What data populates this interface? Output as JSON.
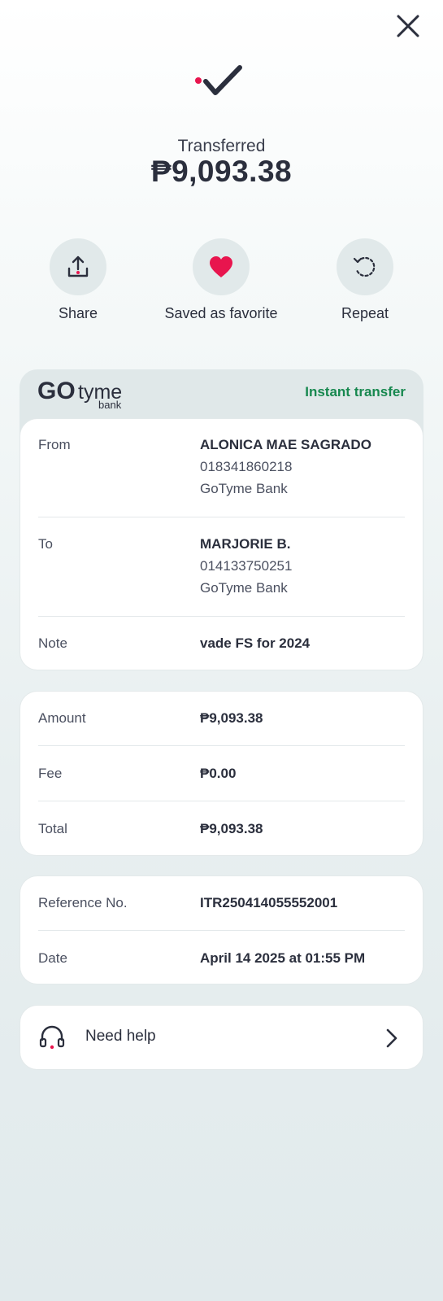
{
  "header": {
    "close_icon": "close-icon"
  },
  "status": {
    "icon": "checkmark-icon",
    "label": "Transferred",
    "amount": "₱9,093.38"
  },
  "actions": [
    {
      "label": "Share",
      "icon": "share-upload-icon"
    },
    {
      "label": "Saved as favorite",
      "icon": "heart-icon"
    },
    {
      "label": "Repeat",
      "icon": "repeat-icon"
    }
  ],
  "bank": {
    "logo_main": "GOtyme",
    "logo_sub": "bank",
    "transfer_type": "Instant transfer"
  },
  "details": {
    "from": {
      "label": "From",
      "name": "ALONICA MAE SAGRADO",
      "account": "018341860218",
      "bank": "GoTyme Bank"
    },
    "to": {
      "label": "To",
      "name": "MARJORIE B.",
      "account": "014133750251",
      "bank": "GoTyme Bank"
    },
    "note": {
      "label": "Note",
      "value": "vade FS for 2024"
    }
  },
  "summary": {
    "amount": {
      "label": "Amount",
      "value": "₱9,093.38"
    },
    "fee": {
      "label": "Fee",
      "value": "₱0.00"
    },
    "total": {
      "label": "Total",
      "value": "₱9,093.38"
    }
  },
  "reference": {
    "ref": {
      "label": "Reference No.",
      "value": "ITR250414055552001"
    },
    "date": {
      "label": "Date",
      "value": "April 14 2025 at 01:55 PM"
    }
  },
  "help": {
    "label": "Need help",
    "icon": "headset-icon"
  },
  "colors": {
    "accent": "#e8154e",
    "brand_green": "#17884f",
    "text": "#2b2f3d"
  }
}
